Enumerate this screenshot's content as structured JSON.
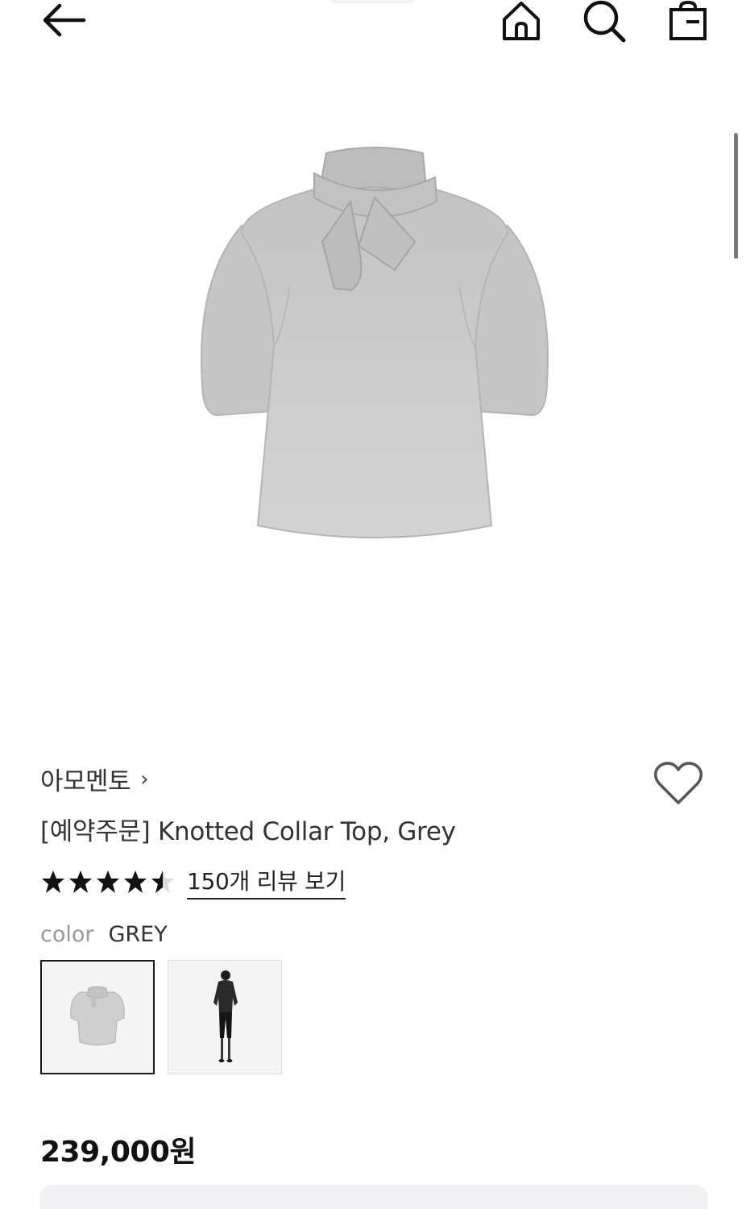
{
  "header": {
    "back_icon": "arrow-left-icon",
    "home_icon": "home-icon",
    "search_icon": "search-icon",
    "cart_icon": "shopping-bag-icon"
  },
  "product": {
    "brand": "아모멘토",
    "brand_chevron": "›",
    "title": "[예약주문] Knotted Collar Top, Grey",
    "rating": 4.5,
    "review_link": "150개 리뷰 보기",
    "color_label": "color",
    "color_value": "GREY",
    "price": "239,000원"
  },
  "colors": {
    "text": "#333333",
    "muted": "#999999",
    "garment": "#c9c9c9"
  }
}
